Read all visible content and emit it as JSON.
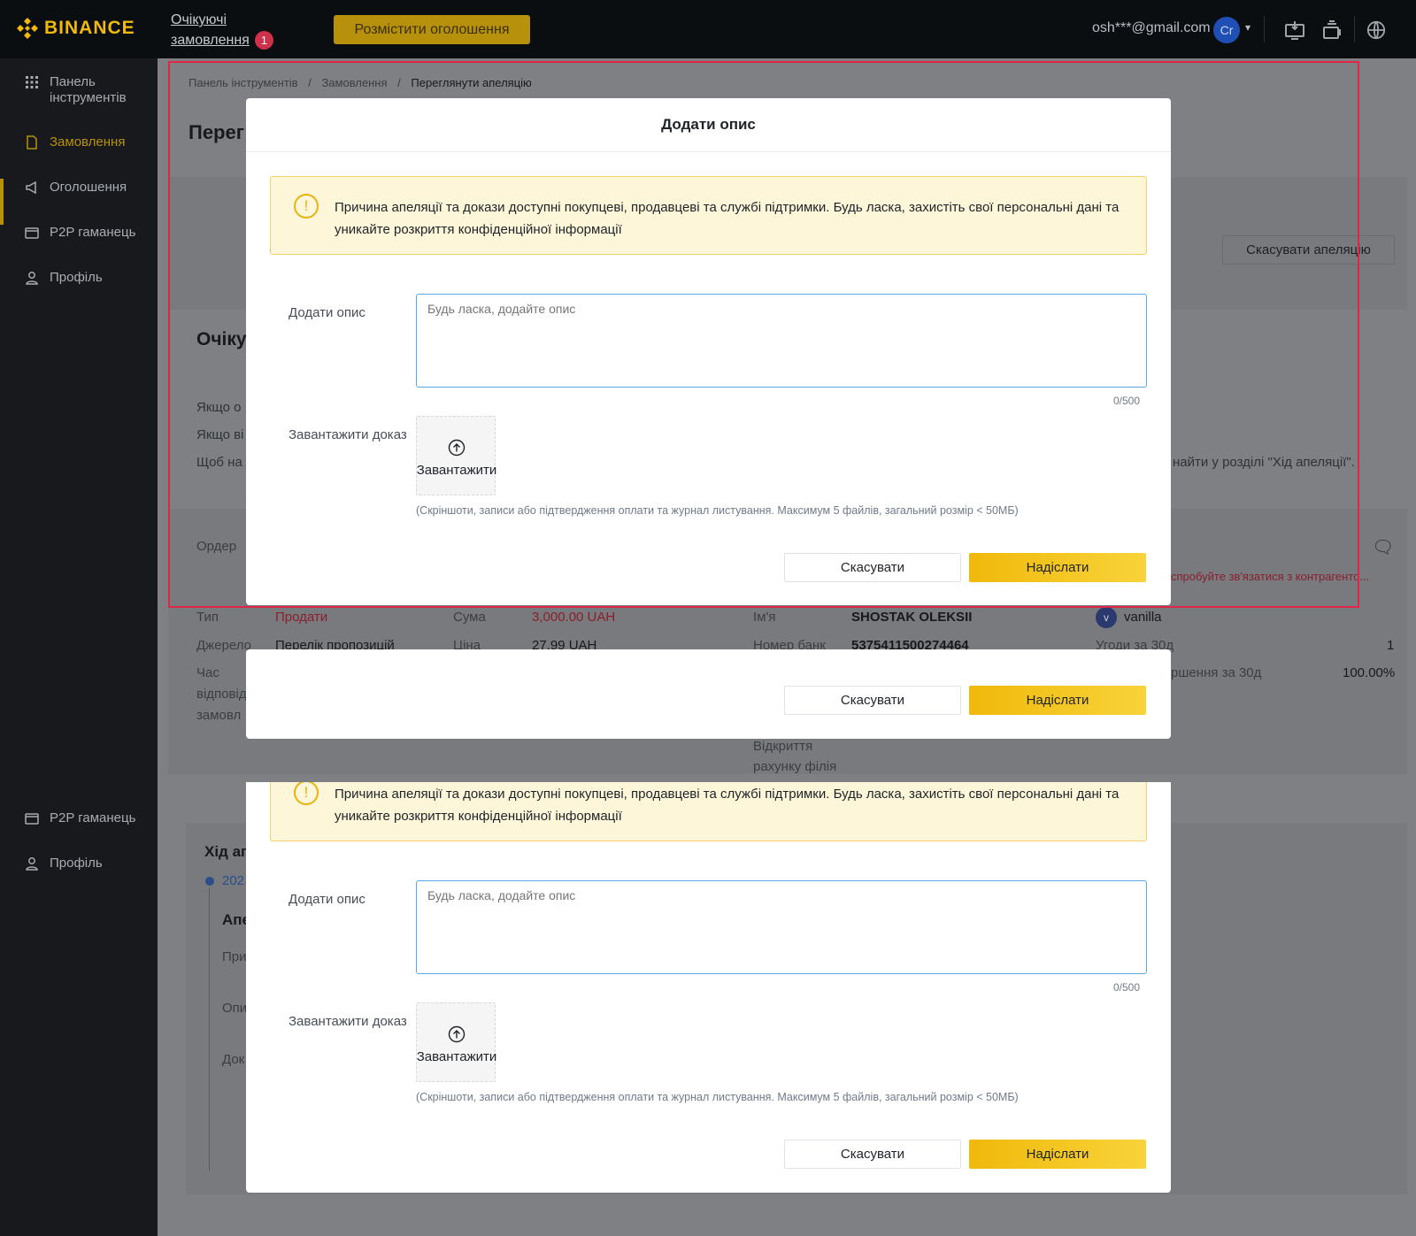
{
  "header": {
    "logo": "BINANCE",
    "pending_orders_line1": "Очікуючі",
    "pending_orders_line2": "замовлення",
    "pending_count": "1",
    "post_ad": "Розмістити оголошення",
    "email": "osh***@gmail.com",
    "avatar_initials": "Cr"
  },
  "sidebar": {
    "items": [
      {
        "label_line1": "Панель",
        "label_line2": "інструментів",
        "icon": "grid-icon"
      },
      {
        "label": "Замовлення",
        "icon": "document-icon"
      },
      {
        "label": "Оголошення",
        "icon": "megaphone-icon"
      },
      {
        "label": "P2P гаманець",
        "icon": "wallet-icon"
      },
      {
        "label": "Профіль",
        "icon": "user-icon"
      }
    ],
    "repeat_items": [
      {
        "label": "P2P гаманець",
        "icon": "wallet-icon"
      },
      {
        "label": "Профіль",
        "icon": "user-icon"
      }
    ]
  },
  "breadcrumb": {
    "item1": "Панель інструментів",
    "item2": "Замовлення",
    "current": "Переглянути апеляцію",
    "sep": "/"
  },
  "background": {
    "page_title": "Перег",
    "cancel_appeal": "Скасувати апеляцію",
    "section_title": "Очіку",
    "line1": "Якщо о",
    "line2": "Якщо ві",
    "line3": "Щоб на",
    "line3_tail": "найти у розділі \"Хід апеляції\".",
    "order": "Ордер",
    "contact_warning": "спробуйте зв'язатися з контрагенто...",
    "type_label": "Тип",
    "type_value": "Продати",
    "amount_label": "Сума",
    "amount_value": "3,000.00 UAH",
    "name_label": "Ім'я",
    "name_value": "SHOSTAK OLEKSII",
    "user_badge": "v",
    "user_name": "vanilla",
    "source_label": "Джерело",
    "source_value": "Перелік пропозицій",
    "price_label": "Ціна",
    "price_value": "27.99 UAH",
    "bank_label": "Номер банк",
    "bank_value": "5375411500274464",
    "trades_label": "Угоди за 30д",
    "trades_value": "1",
    "completion_label": "ршення за 30д",
    "completion_value": "100.00%",
    "time_label_1": "Час",
    "time_label_2": "відповід",
    "time_label_3": "замовл",
    "branch_label_1": "Відкриття",
    "branch_label_2": "рахунку філія",
    "progress_title": "Хід ап",
    "progress_date": "202",
    "progress_item": "Апе",
    "progress_l1": "При",
    "progress_l2": "Опи",
    "progress_l3": "Док"
  },
  "modal": {
    "title": "Додати опис",
    "notice": "Причина апеляції та докази доступні покупцеві, продавцеві та службі підтримки. Будь ласка, захистіть свої персональні дані та уникайте розкриття конфіденційної інформації",
    "desc_label": "Додати опис",
    "desc_placeholder": "Будь ласка, додайте опис",
    "counter": "0/500",
    "upload_label": "Завантажити доказ",
    "upload_button": "Завантажити",
    "upload_hint": "(Скріншоти, записи або підтвердження оплати та журнал листування. Максимум 5 файлів, загальний розмір < 50МБ)",
    "cancel": "Скасувати",
    "submit": "Надіслати"
  },
  "colors": {
    "accent": "#F0B90B",
    "danger": "#CF304A",
    "frame": "#E0254A"
  }
}
